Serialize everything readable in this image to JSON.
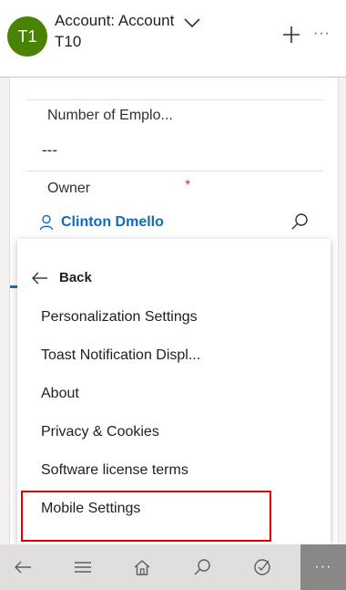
{
  "header": {
    "avatar_initials": "T1",
    "title_line1": "Account: Account",
    "title_line2": "T10",
    "more_label": "···"
  },
  "form": {
    "employees_label": "Number of Emplo...",
    "employees_value": "---",
    "owner_label": "Owner",
    "owner_required_mark": "*",
    "owner_value": "Clinton Dmello"
  },
  "menu": {
    "back_label": "Back",
    "items": [
      "Personalization Settings",
      "Toast Notification Displ...",
      "About",
      "Privacy & Cookies",
      "Software license terms",
      "Mobile Settings"
    ],
    "highlighted_item": "Mobile Settings"
  },
  "bottom_nav": {
    "icons": [
      "back-arrow-icon",
      "hamburger-menu-icon",
      "home-icon",
      "search-icon",
      "target-icon"
    ],
    "more_label": "···"
  },
  "colors": {
    "avatar_bg": "#498205",
    "link": "#0f6cbd",
    "required": "#d13438",
    "highlight_border": "#e00000"
  }
}
